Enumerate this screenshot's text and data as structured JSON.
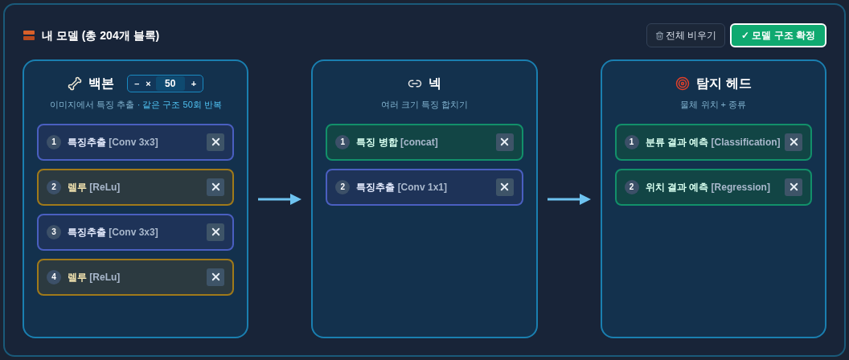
{
  "title": "내 모델 (총 204개 블록)",
  "buttons": [
    {
      "label": "전체 비우기",
      "kind": "clear"
    },
    {
      "label": "✓ 모델 구조 확정",
      "kind": "confirm"
    }
  ],
  "stages": [
    {
      "kind": "backbone",
      "title": "백본",
      "subtitle": "이미지에서 특징 추출",
      "note": "· 같은 구조 50회 반복",
      "repeat": {
        "minus": "–",
        "times": "×",
        "value": "50",
        "plus": "+"
      },
      "blocks": [
        {
          "number": "1",
          "name": "특징추출",
          "op": "[Conv 3x3]",
          "kind": "conv"
        },
        {
          "number": "2",
          "name": "렐루",
          "op": "[ReLu]",
          "kind": "relu"
        },
        {
          "number": "3",
          "name": "특징추출",
          "op": "[Conv 3x3]",
          "kind": "conv"
        },
        {
          "number": "4",
          "name": "렐루",
          "op": "[ReLu]",
          "kind": "relu"
        }
      ]
    },
    {
      "kind": "neck",
      "title": "넥",
      "subtitle": "여러 크기 특징 합치기",
      "blocks": [
        {
          "number": "1",
          "name": "특징 병합",
          "op": "[concat]",
          "kind": "merge"
        },
        {
          "number": "2",
          "name": "특징추출",
          "op": "[Conv 1x1]",
          "kind": "conv"
        }
      ]
    },
    {
      "kind": "head",
      "title": "탐지 헤드",
      "subtitle": "물체 위치 + 종류",
      "blocks": [
        {
          "number": "1",
          "name": "분류 결과 예측",
          "op": "[Classification]",
          "kind": "merge"
        },
        {
          "number": "2",
          "name": "위치 결과 예측",
          "op": "[Regression]",
          "kind": "merge"
        }
      ]
    }
  ]
}
